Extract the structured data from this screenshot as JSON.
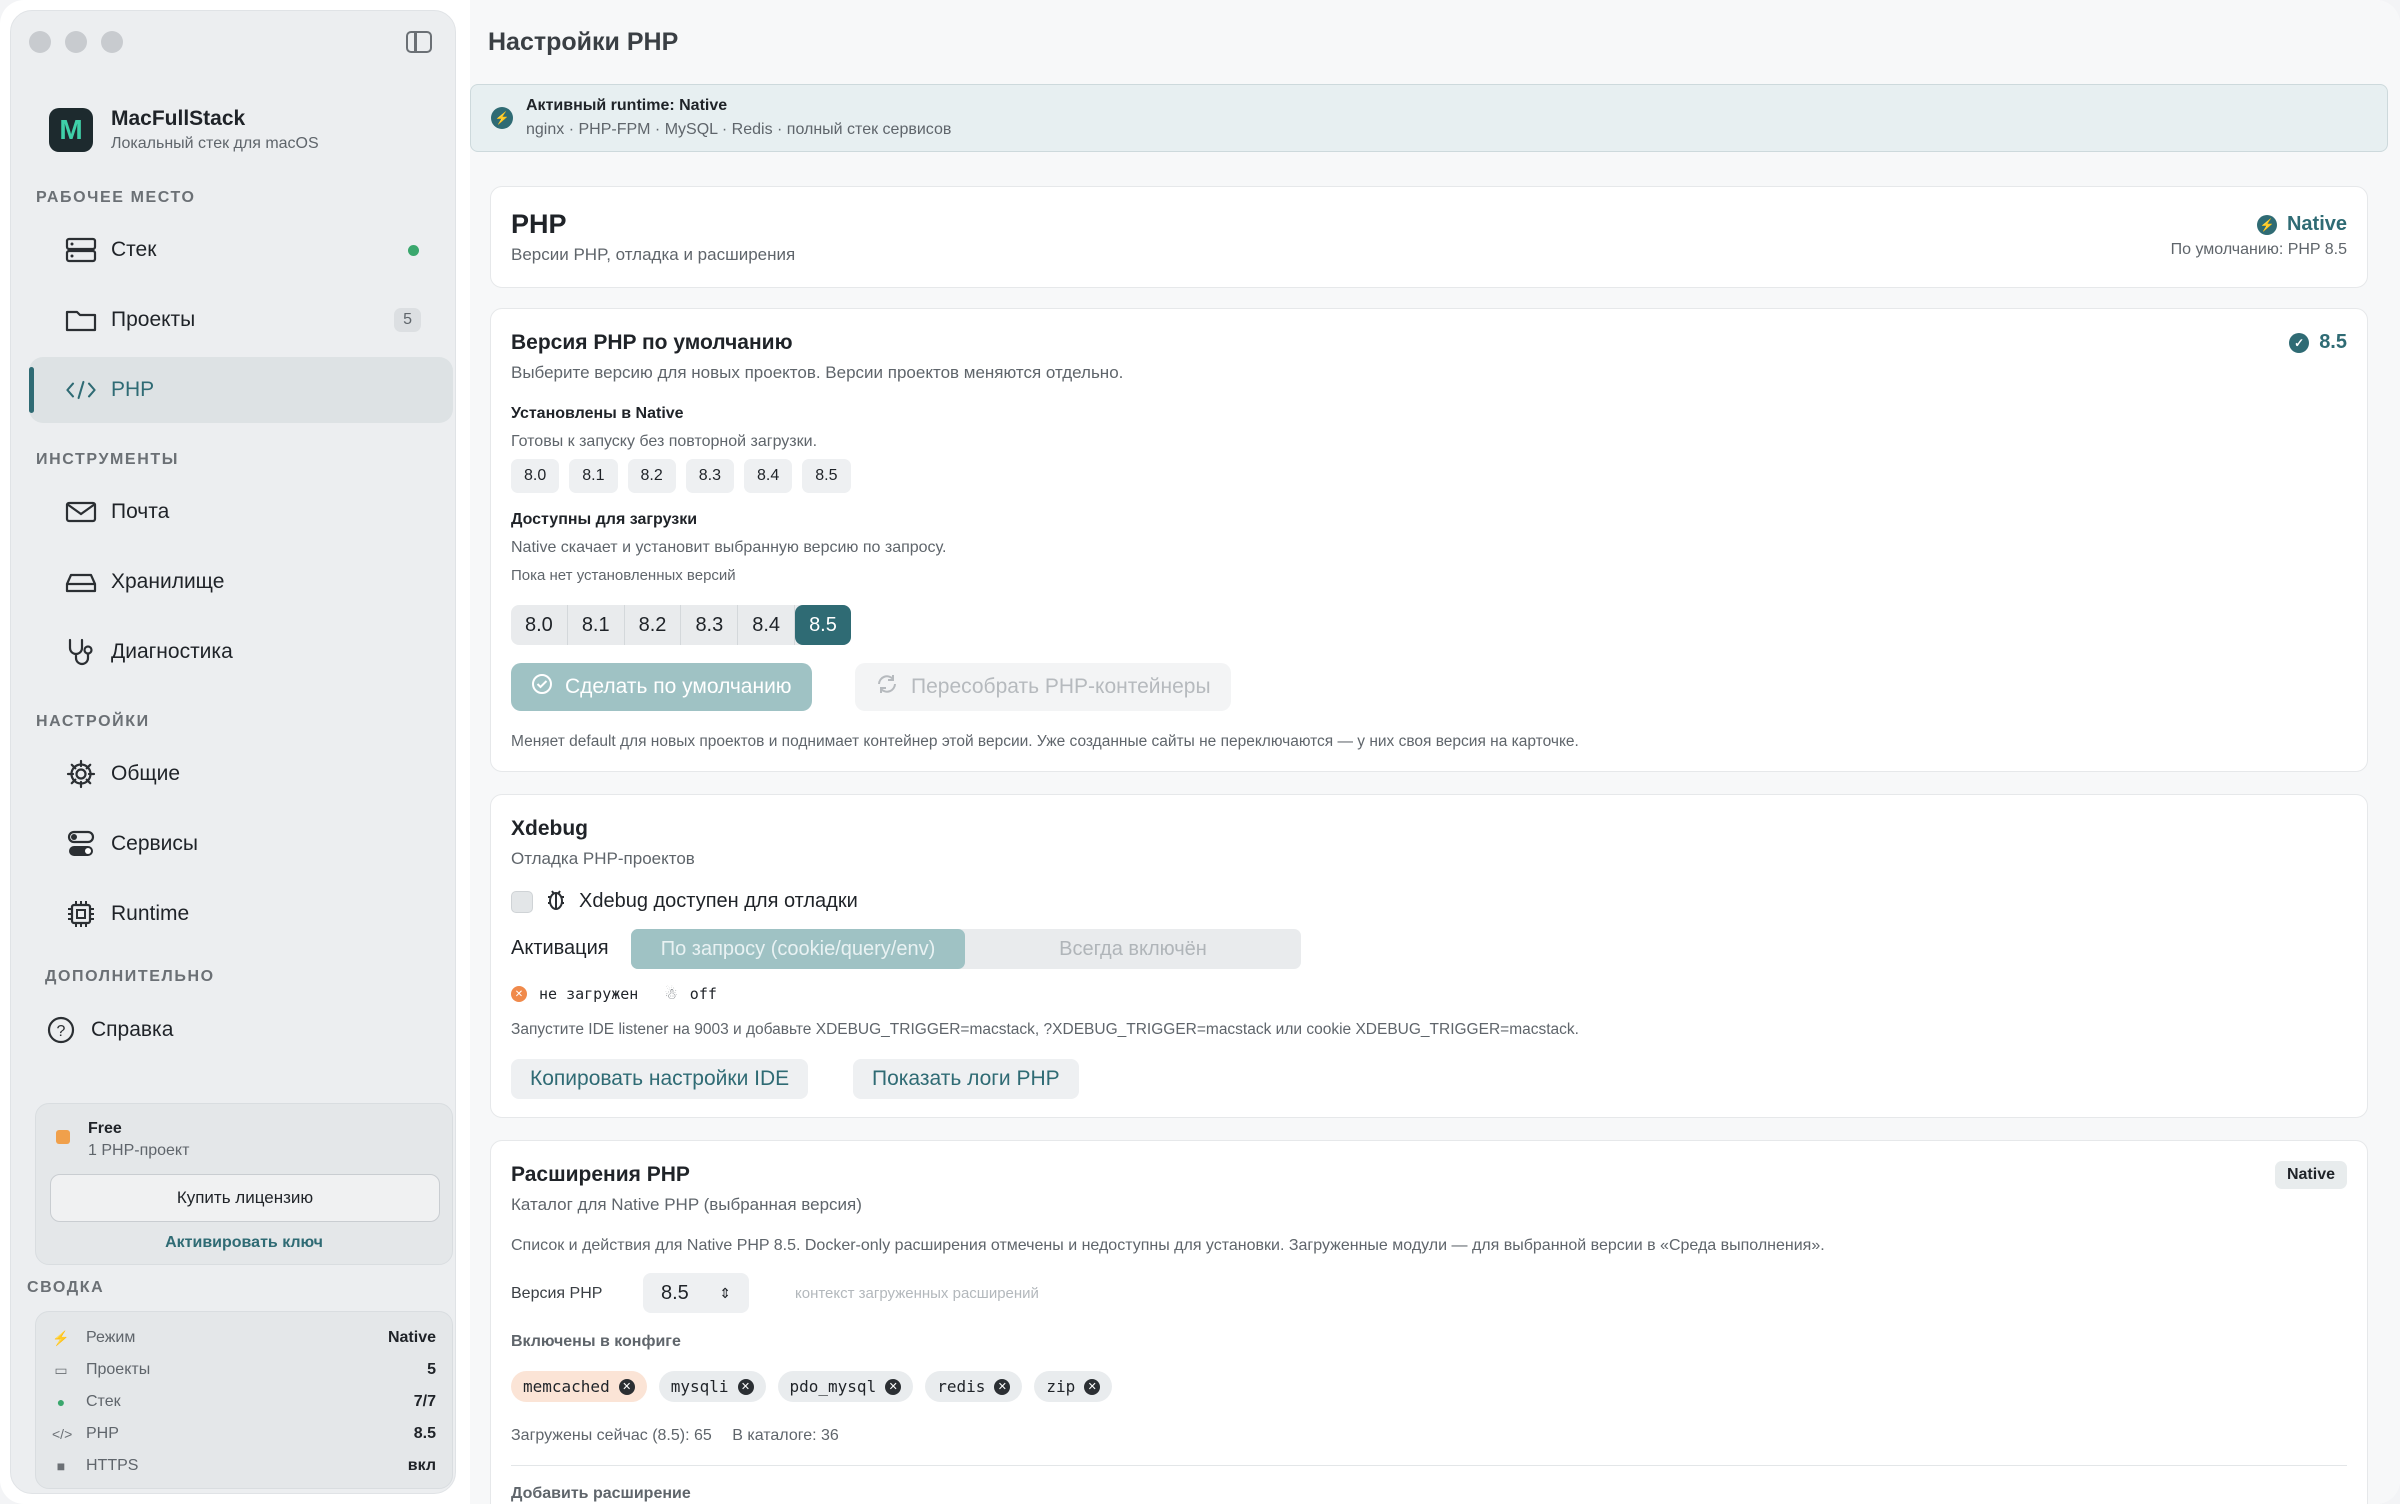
{
  "app": {
    "name": "MacFullStack",
    "subtitle": "Локальный стек для macOS",
    "logo_letter": "M"
  },
  "sidebar": {
    "sections": {
      "workspace": "РАБОЧЕЕ МЕСТО",
      "tools": "ИНСТРУМЕНТЫ",
      "settings": "НАСТРОЙКИ",
      "extra": "ДОПОЛНИТЕЛЬНО",
      "summary": "СВОДКА"
    },
    "items": [
      {
        "label": "Стек",
        "icon": "server-icon"
      },
      {
        "label": "Проекты",
        "icon": "folder-icon",
        "count": "5"
      },
      {
        "label": "PHP",
        "icon": "code-icon",
        "active": true
      },
      {
        "label": "Почта",
        "icon": "mail-icon"
      },
      {
        "label": "Хранилище",
        "icon": "drive-icon"
      },
      {
        "label": "Диагностика",
        "icon": "stethoscope-icon"
      },
      {
        "label": "Общие",
        "icon": "gear-icon"
      },
      {
        "label": "Сервисы",
        "icon": "toggles-icon"
      },
      {
        "label": "Runtime",
        "icon": "chip-icon"
      },
      {
        "label": "Справка",
        "icon": "help-icon"
      }
    ],
    "license": {
      "title": "Free",
      "subtitle": "1 PHP-проект",
      "buy": "Купить лицензию",
      "activate": "Активировать ключ"
    },
    "summary": [
      {
        "label": "Режим",
        "value": "Native"
      },
      {
        "label": "Проекты",
        "value": "5"
      },
      {
        "label": "Стек",
        "value": "7/7"
      },
      {
        "label": "PHP",
        "value": "8.5"
      },
      {
        "label": "HTTPS",
        "value": "вкл"
      }
    ]
  },
  "header": {
    "title": "Настройки PHP"
  },
  "banner": {
    "title": "Активный runtime: Native",
    "subtitle": "nginx · PHP-FPM · MySQL · Redis · полный стек сервисов"
  },
  "php_card": {
    "title": "PHP",
    "subtitle": "Версии PHP, отладка и расширения",
    "badge": "Native",
    "default_note": "По умолчанию: PHP 8.5"
  },
  "default_version": {
    "title": "Версия PHP по умолчанию",
    "subtitle": "Выберите версию для новых проектов. Версии проектов меняются отдельно.",
    "current": "8.5",
    "installed_title": "Установлены в Native",
    "installed_sub": "Готовы к запуску без повторной загрузки.",
    "installed": [
      "8.0",
      "8.1",
      "8.2",
      "8.3",
      "8.4",
      "8.5"
    ],
    "available_title": "Доступны для загрузки",
    "available_sub": "Native скачает и установит выбранную версию по запросу.",
    "available_note": "Пока нет установленных версий",
    "versions": [
      "8.0",
      "8.1",
      "8.2",
      "8.3",
      "8.4",
      "8.5"
    ],
    "selected": "8.5",
    "make_default": "Сделать по умолчанию",
    "rebuild": "Пересобрать PHP-контейнеры",
    "footnote": "Меняет default для новых проектов и поднимает контейнер этой версии. Уже созданные сайты не переключаются — у них своя версия на карточке."
  },
  "xdebug": {
    "title": "Xdebug",
    "subtitle": "Отладка PHP-проектов",
    "checkbox_label": "Xdebug доступен для отладки",
    "activation_label": "Активация",
    "mode_on_request": "По запросу (cookie/query/env)",
    "mode_always": "Всегда включён",
    "status_loaded": "не загружен",
    "status_mode": "off",
    "hint": "Запустите IDE listener на 9003 и добавьте XDEBUG_TRIGGER=macstack, ?XDEBUG_TRIGGER=macstack или cookie XDEBUG_TRIGGER=macstack.",
    "copy_ide": "Копировать настройки IDE",
    "show_logs": "Показать логи PHP"
  },
  "extensions": {
    "title": "Расширения PHP",
    "subtitle": "Каталог для Native PHP (выбранная версия)",
    "badge": "Native",
    "description": "Список и действия для Native PHP 8.5. Docker-only расширения отмечены и недоступны для установки. Загруженные модули — для выбранной версии в «Среда выполнения».",
    "version_label": "Версия PHP",
    "version_value": "8.5",
    "context_hint": "контекст загруженных расширений",
    "enabled_label": "Включены в конфиге",
    "enabled": [
      "memcached",
      "mysqli",
      "pdo_mysql",
      "redis",
      "zip"
    ],
    "loaded_now": "Загружены сейчас (8.5): 65",
    "in_catalog": "В каталоге: 36",
    "add_label": "Добавить расширение"
  }
}
